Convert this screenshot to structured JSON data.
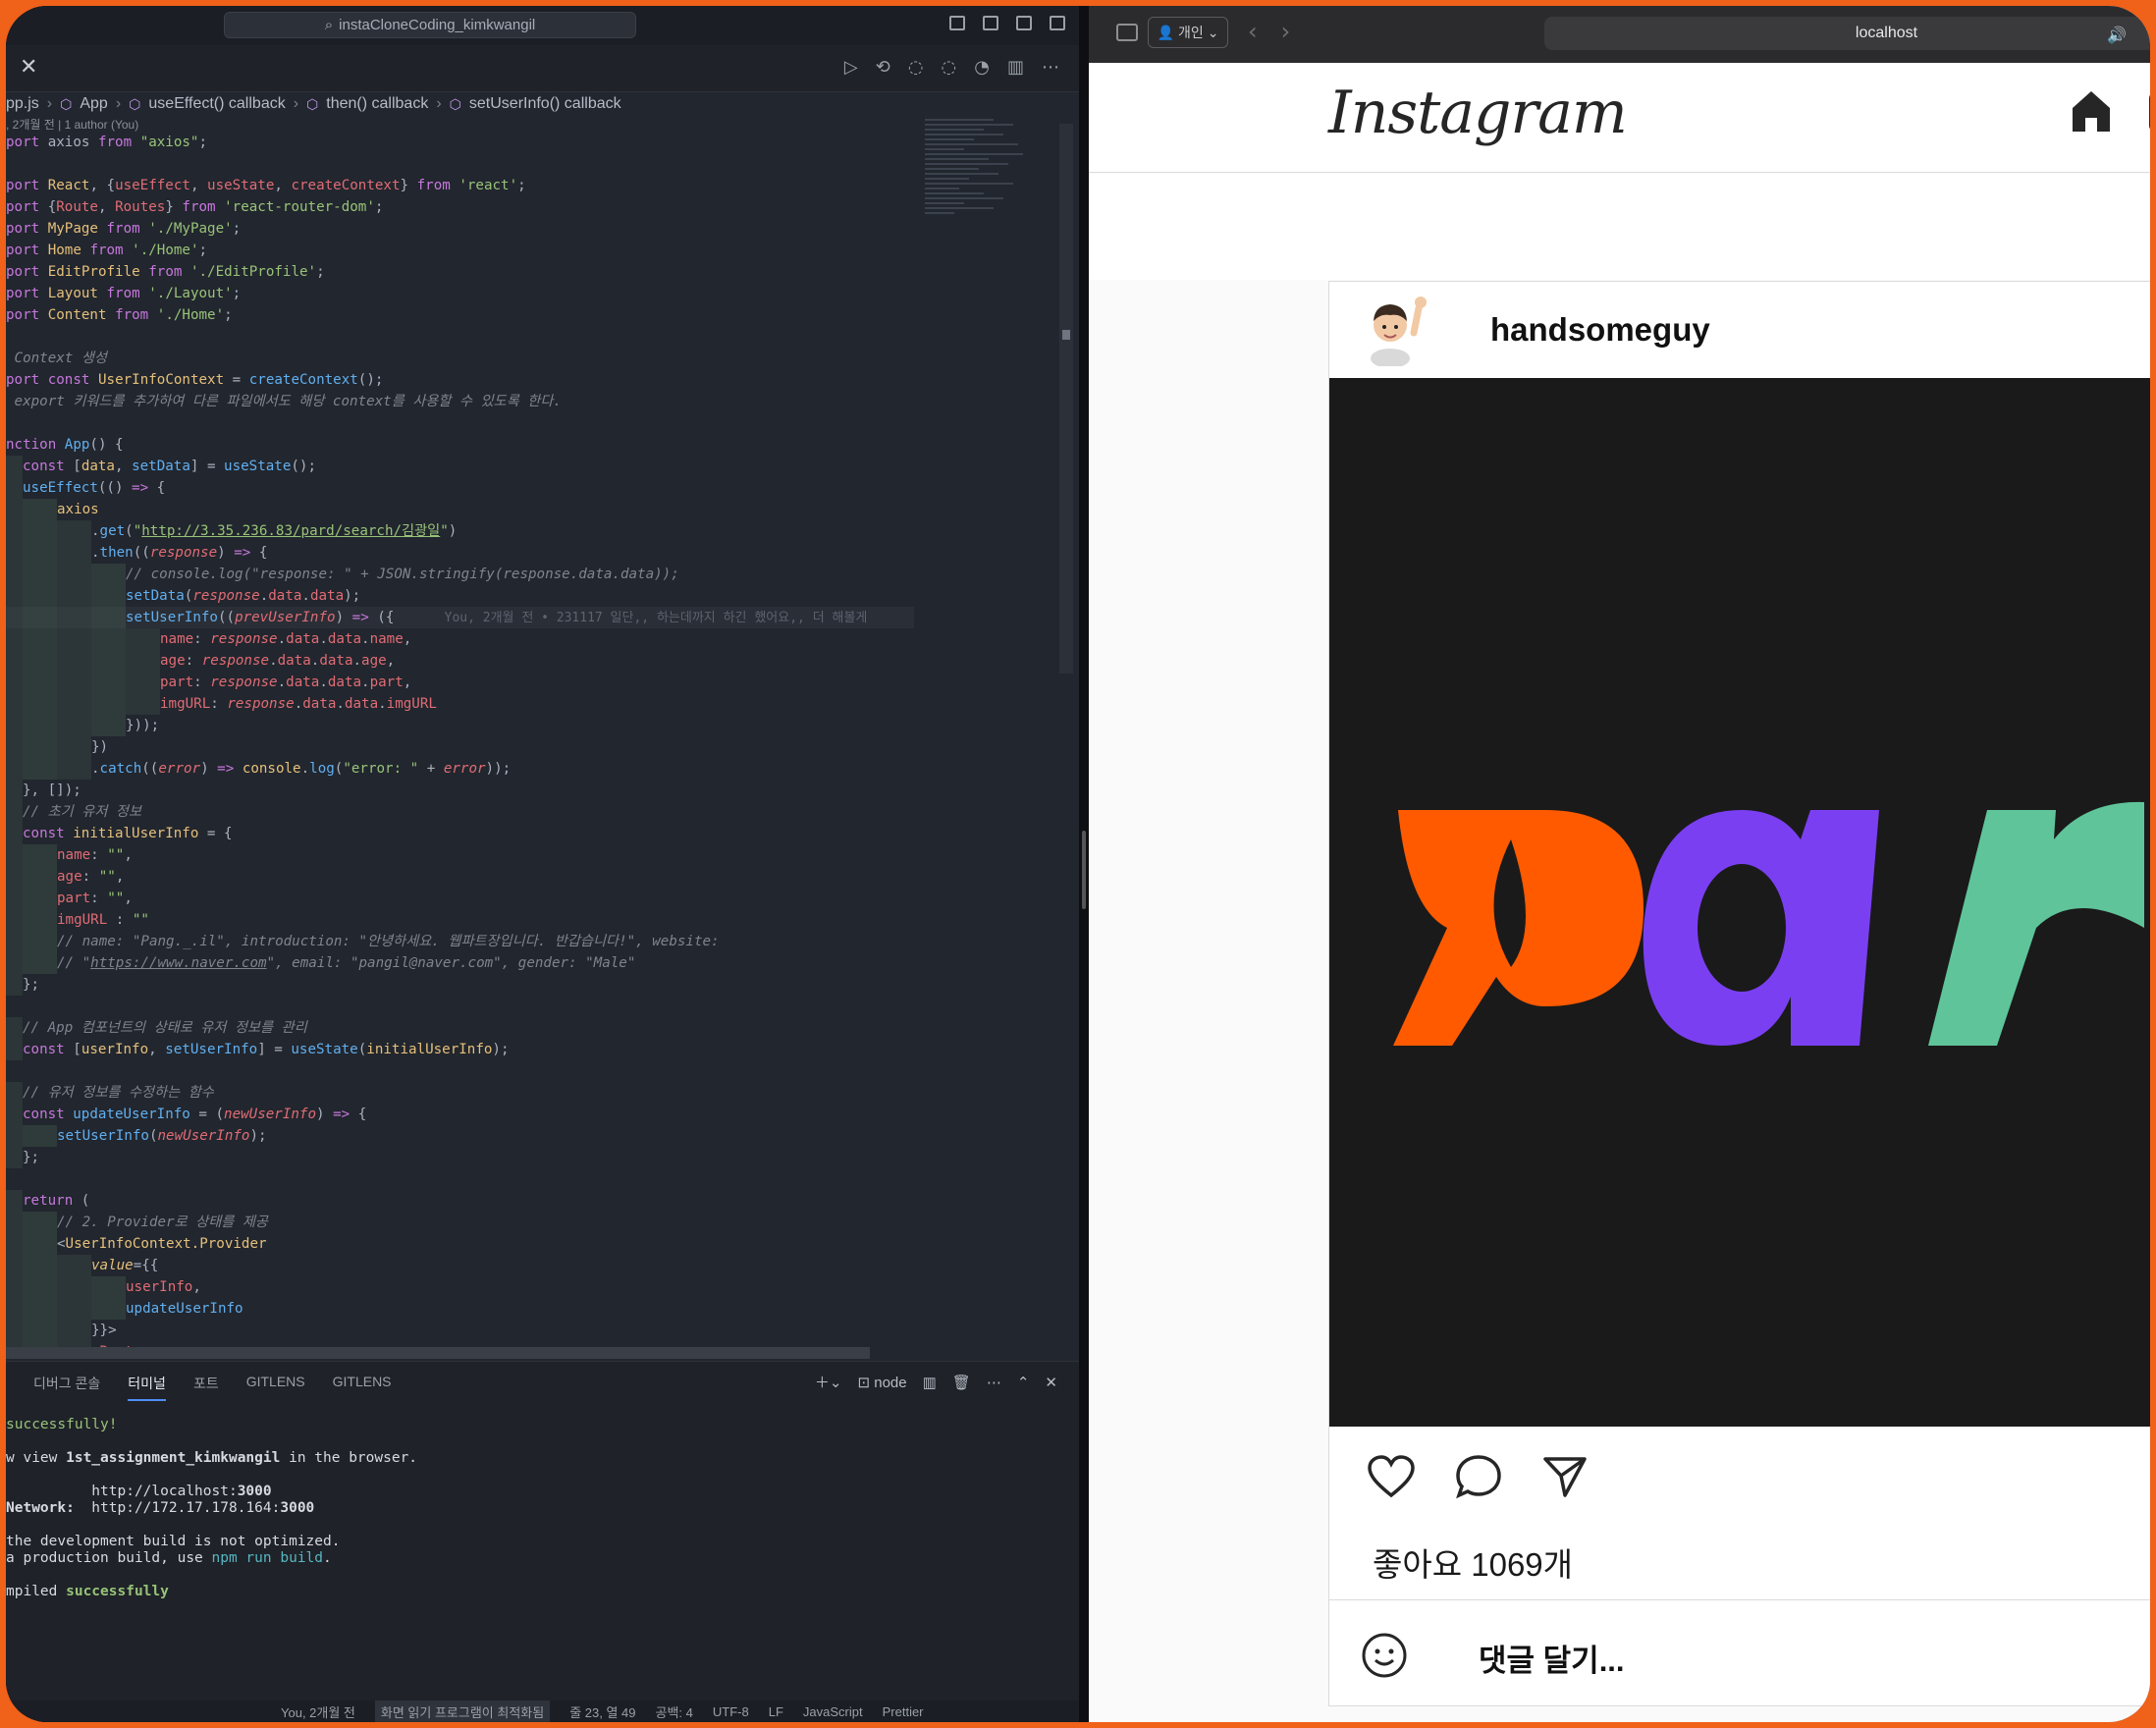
{
  "vscode": {
    "search_text": "instaCloneCoding_kimkwangil",
    "breadcrumb": [
      "pp.js",
      "App",
      "useEffect() callback",
      "then() callback",
      "setUserInfo() callback"
    ],
    "blame": ", 2개월 전 | 1 author (You)",
    "ghost_blame": "You, 2개월 전 • 231117 일단,, 하는데까지 하긴 했어요,, 더 해볼게",
    "panel_tabs": [
      "디버그 콘솔",
      "터미널",
      "포트",
      "GITLENS",
      "GITLENS"
    ],
    "panel_active_tab": "터미널",
    "terminal_shell": "node",
    "terminal": {
      "l1": "successfully!",
      "l2a": "w view ",
      "l2b": "1st_assignment_kimkwangil",
      "l2c": " in the browser.",
      "l3a": "          http://localhost:",
      "l3b": "3000",
      "l4a": "Network:",
      "l4b": "  http://172.17.178.164:",
      "l4c": "3000",
      "l5": "the development build is not optimized.",
      "l6a": "a production build, use ",
      "l6b": "npm run build",
      "l6c": ".",
      "l7a": "mpiled ",
      "l7b": "successfully"
    },
    "status": {
      "blame": "You, 2개월 전",
      "screenreader": "화면 읽기 프로그램이 최적화됨",
      "position": "줄 23, 열 49",
      "spaces": "공백: 4",
      "encoding": "UTF-8",
      "eol": "LF",
      "language": "JavaScript",
      "formatter": "Prettier"
    }
  },
  "browser": {
    "profile_label": "개인",
    "url": "localhost"
  },
  "instagram": {
    "logo": "Instagram",
    "username": "handsomeguy",
    "likes": "좋아요 1069개",
    "comment_placeholder": "댓글 달기..."
  },
  "colors": {
    "frame": "#f0611a",
    "pard_orange": "#ff5a00",
    "pard_purple": "#7b3ff2",
    "pard_green": "#5fc49a",
    "pard_blue": "#5a6cff"
  },
  "icons": [
    "search-icon",
    "close-icon",
    "run-icon",
    "split-editor-icon",
    "more-icon",
    "home-icon",
    "heart-icon",
    "comment-icon",
    "share-icon",
    "smile-icon",
    "speaker-icon"
  ]
}
